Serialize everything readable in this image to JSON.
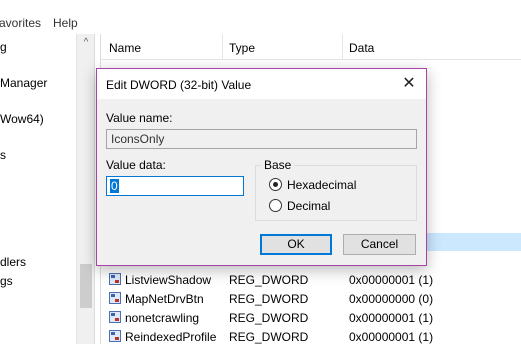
{
  "menubar": {
    "favorites": "avorites",
    "help": "Help"
  },
  "tree": {
    "items": [
      "g",
      "Manager",
      "Wow64)",
      "s",
      "dlers",
      "gs"
    ]
  },
  "list": {
    "headers": {
      "name": "Name",
      "type": "Type",
      "data": "Data"
    },
    "rows": [
      {
        "name": "ListviewShadow",
        "type": "REG_DWORD",
        "data": "0x00000001 (1)"
      },
      {
        "name": "MapNetDrvBtn",
        "type": "REG_DWORD",
        "data": "0x00000000 (0)"
      },
      {
        "name": "nonetcrawling",
        "type": "REG_DWORD",
        "data": "0x00000001 (1)"
      },
      {
        "name": "ReindexedProfile",
        "type": "REG_DWORD",
        "data": "0x00000001 (1)"
      }
    ]
  },
  "dialog": {
    "title": "Edit DWORD (32-bit) Value",
    "value_name_label": "Value name:",
    "value_name": "IconsOnly",
    "value_data_label": "Value data:",
    "value_data": "0",
    "base_label": "Base",
    "radios": [
      {
        "label": "Hexadecimal",
        "checked": true
      },
      {
        "label": "Decimal",
        "checked": false
      }
    ],
    "ok": "OK",
    "cancel": "Cancel",
    "close_glyph": "✕"
  },
  "colors": {
    "dialog_border": "#a742a6",
    "accent": "#0078d7",
    "selection": "#cce8ff"
  }
}
